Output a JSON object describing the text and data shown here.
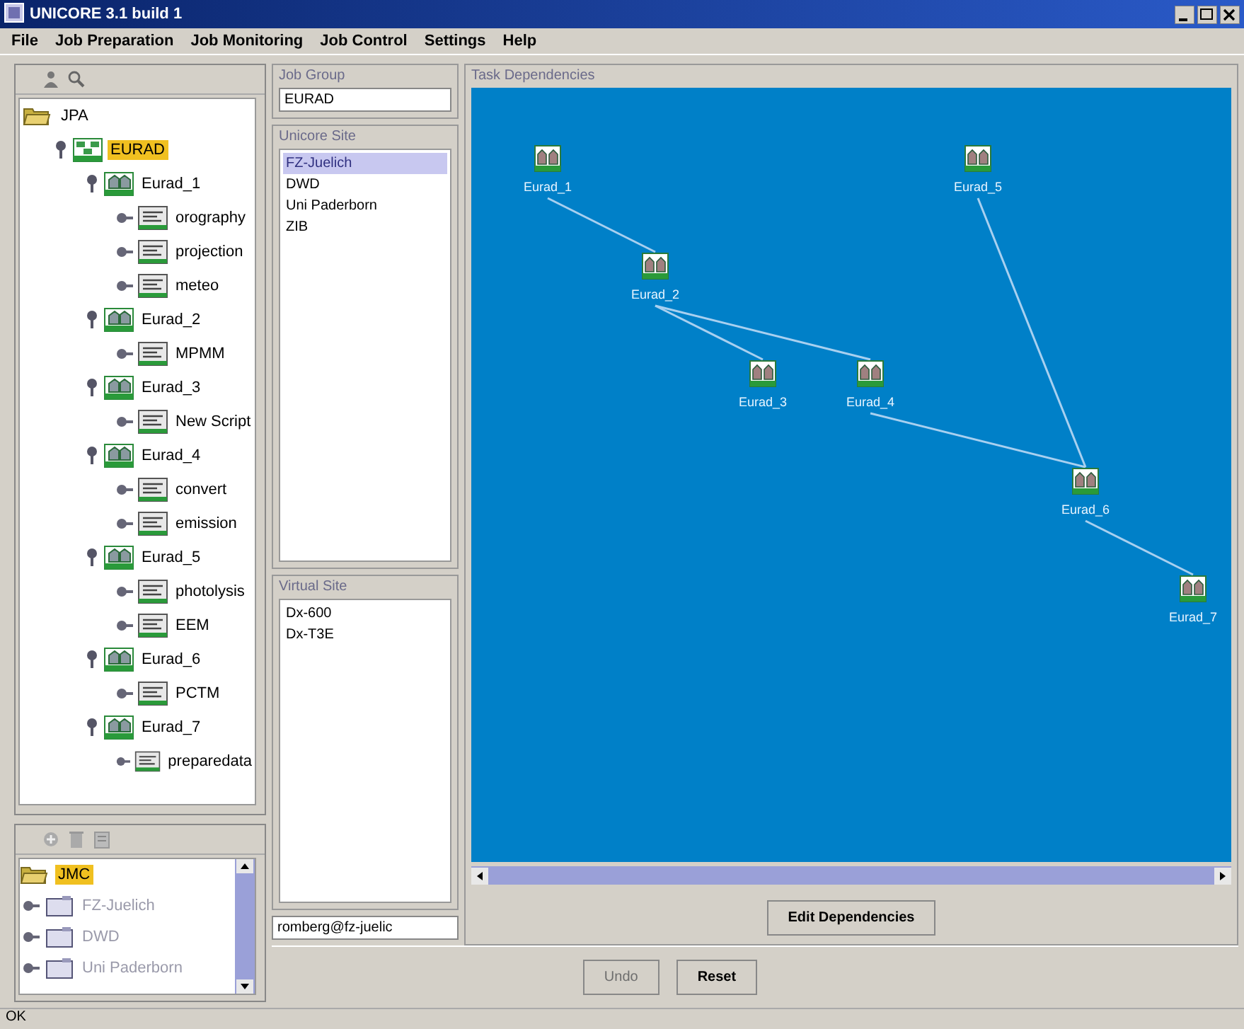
{
  "window": {
    "title": "UNICORE 3.1 build 1"
  },
  "menu": [
    "File",
    "Job Preparation",
    "Job Monitoring",
    "Job Control",
    "Settings",
    "Help"
  ],
  "job_tree": {
    "label": "JPA",
    "kind": "root",
    "children": [
      {
        "label": "EURAD",
        "kind": "group",
        "selected": true,
        "expanded": true,
        "children": [
          {
            "label": "Eurad_1",
            "kind": "task",
            "selected": false,
            "expanded": true,
            "children": [
              {
                "label": "orography",
                "kind": "script",
                "selected": false
              },
              {
                "label": "projection",
                "kind": "script",
                "selected": false
              },
              {
                "label": "meteo",
                "kind": "script",
                "selected": false
              }
            ]
          },
          {
            "label": "Eurad_2",
            "kind": "task",
            "selected": false,
            "expanded": true,
            "children": [
              {
                "label": "MPMM",
                "kind": "script",
                "selected": false
              }
            ]
          },
          {
            "label": "Eurad_3",
            "kind": "task",
            "selected": false,
            "expanded": true,
            "children": [
              {
                "label": "New Script",
                "kind": "script",
                "selected": false
              }
            ]
          },
          {
            "label": "Eurad_4",
            "kind": "task",
            "selected": false,
            "expanded": true,
            "children": [
              {
                "label": "convert",
                "kind": "script",
                "selected": false
              },
              {
                "label": "emission",
                "kind": "script",
                "selected": false
              }
            ]
          },
          {
            "label": "Eurad_5",
            "kind": "task",
            "selected": false,
            "expanded": true,
            "children": [
              {
                "label": "photolysis",
                "kind": "script",
                "selected": false
              },
              {
                "label": "EEM",
                "kind": "script",
                "selected": false
              }
            ]
          },
          {
            "label": "Eurad_6",
            "kind": "task",
            "selected": false,
            "expanded": true,
            "children": [
              {
                "label": "PCTM",
                "kind": "script",
                "selected": false
              }
            ]
          },
          {
            "label": "Eurad_7",
            "kind": "task",
            "selected": false,
            "expanded": true,
            "children": [
              {
                "label": "preparedata",
                "kind": "script",
                "selected": false
              }
            ]
          }
        ]
      }
    ]
  },
  "site_tree": {
    "label": "JMC",
    "selected": true,
    "children": [
      {
        "label": "FZ-Juelich",
        "disabled": true
      },
      {
        "label": "DWD",
        "disabled": true
      },
      {
        "label": "Uni Paderborn",
        "disabled": true
      }
    ]
  },
  "job_group": {
    "title": "Job Group",
    "value": "EURAD"
  },
  "unicore_sites": {
    "title": "Unicore Site",
    "items": [
      {
        "label": "FZ-Juelich",
        "selected": true
      },
      {
        "label": "DWD",
        "selected": false
      },
      {
        "label": "Uni Paderborn",
        "selected": false
      },
      {
        "label": "ZIB",
        "selected": false
      }
    ]
  },
  "virtual_sites": {
    "title": "Virtual Site",
    "items": [
      {
        "label": "Dx-600",
        "selected": false
      },
      {
        "label": "Dx-T3E",
        "selected": false
      }
    ]
  },
  "user_field": {
    "value": "romberg@fz-juelic"
  },
  "dependencies": {
    "title": "Task Dependencies",
    "nodes": [
      "Eurad_1",
      "Eurad_2",
      "Eurad_3",
      "Eurad_4",
      "Eurad_5",
      "Eurad_6",
      "Eurad_7"
    ],
    "edit_button": "Edit Dependencies"
  },
  "buttons": [
    {
      "label": "Undo",
      "disabled": true
    },
    {
      "label": "Reset",
      "disabled": false
    }
  ],
  "status_bar": "OK"
}
